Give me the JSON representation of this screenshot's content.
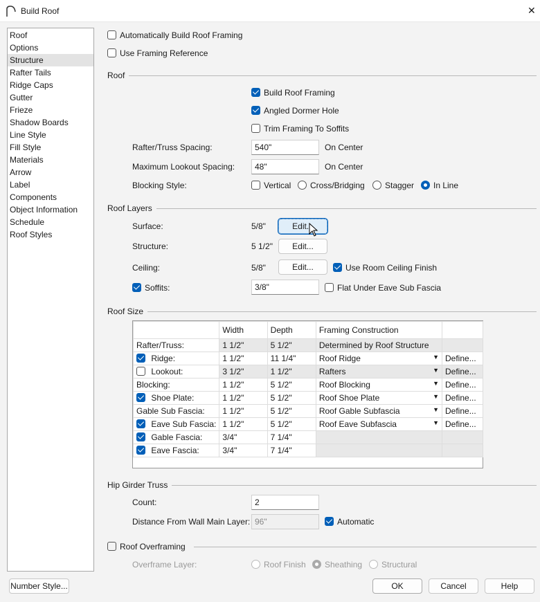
{
  "window": {
    "title": "Build Roof",
    "close": "✕"
  },
  "sidebar": {
    "items": [
      "Roof",
      "Options",
      "Structure",
      "Rafter Tails",
      "Ridge Caps",
      "Gutter",
      "Frieze",
      "Shadow Boards",
      "Line Style",
      "Fill Style",
      "Materials",
      "Arrow",
      "Label",
      "Components",
      "Object Information",
      "Schedule",
      "Roof Styles"
    ],
    "selected": "Structure"
  },
  "top": {
    "auto_build": {
      "label": "Automatically Build Roof Framing",
      "checked": false
    },
    "framing_ref": {
      "label": "Use Framing Reference",
      "checked": false
    }
  },
  "roof": {
    "section": "Roof",
    "build_framing": {
      "label": "Build Roof Framing",
      "checked": true
    },
    "angled_dormer": {
      "label": "Angled Dormer Hole",
      "checked": true
    },
    "trim_soffits": {
      "label": "Trim Framing To Soffits",
      "checked": false
    },
    "spacing_label": "Rafter/Truss Spacing:",
    "spacing_value": "540\"",
    "on_center": "On Center",
    "lookout_label": "Maximum Lookout Spacing:",
    "lookout_value": "48\"",
    "blocking_label": "Blocking Style:",
    "blocking": {
      "vertical": "Vertical",
      "cross": "Cross/Bridging",
      "stagger": "Stagger",
      "inline": "In Line",
      "selected": "In Line"
    }
  },
  "layers": {
    "section": "Roof Layers",
    "surface_label": "Surface:",
    "surface_value": "5/8\"",
    "structure_label": "Structure:",
    "structure_value": "5 1/2\"",
    "ceiling_label": "Ceiling:",
    "ceiling_value": "5/8\"",
    "edit": "Edit...",
    "use_room": "Use Room Ceiling Finish",
    "soffits_label": "Soffits:",
    "soffits_value": "3/8\"",
    "flat_under": "Flat Under Eave Sub Fascia"
  },
  "size": {
    "section": "Roof Size",
    "headers": [
      "",
      "Width",
      "Depth",
      "Framing Construction",
      ""
    ],
    "rows": [
      {
        "label": "Rafter/Truss:",
        "check": null,
        "width": "1 1/2\"",
        "depth": "5 1/2\"",
        "framing": "Determined by Roof Structure",
        "define": "",
        "dropdown": false,
        "gray": true
      },
      {
        "label": "Ridge:",
        "check": true,
        "width": "1 1/2\"",
        "depth": "11 1/4\"",
        "framing": "Roof Ridge",
        "define": "Define...",
        "dropdown": true
      },
      {
        "label": "Lookout:",
        "check": false,
        "width": "3 1/2\"",
        "depth": "1 1/2\"",
        "framing": "Rafters",
        "define": "Define...",
        "dropdown": true,
        "gray": true
      },
      {
        "label": "Blocking:",
        "check": null,
        "width": "1 1/2\"",
        "depth": "5 1/2\"",
        "framing": "Roof Blocking",
        "define": "Define...",
        "dropdown": true
      },
      {
        "label": "Shoe Plate:",
        "check": true,
        "width": "1 1/2\"",
        "depth": "5 1/2\"",
        "framing": "Roof Shoe Plate",
        "define": "Define...",
        "dropdown": true
      },
      {
        "label": "Gable Sub Fascia:",
        "check": null,
        "width": "1 1/2\"",
        "depth": "5 1/2\"",
        "framing": "Roof Gable Subfascia",
        "define": "Define...",
        "dropdown": true
      },
      {
        "label": "Eave Sub Fascia:",
        "check": true,
        "width": "1 1/2\"",
        "depth": "5 1/2\"",
        "framing": "Roof Eave Subfascia",
        "define": "Define...",
        "dropdown": true
      },
      {
        "label": "Gable Fascia:",
        "check": true,
        "width": "3/4\"",
        "depth": "7 1/4\"",
        "framing": "",
        "define": "",
        "dropdown": false
      },
      {
        "label": "Eave Fascia:",
        "check": true,
        "width": "3/4\"",
        "depth": "7 1/4\"",
        "framing": "",
        "define": "",
        "dropdown": false
      }
    ]
  },
  "hip": {
    "section": "Hip Girder Truss",
    "count_label": "Count:",
    "count_value": "2",
    "distance_label": "Distance From Wall Main Layer:",
    "distance_value": "96\"",
    "automatic": "Automatic"
  },
  "overframe": {
    "label": "Roof Overframing",
    "layer_label": "Overframe Layer:",
    "options": [
      "Roof Finish",
      "Sheathing",
      "Structural"
    ],
    "selected": "Sheathing"
  },
  "buttons": {
    "number_style": "Number Style...",
    "ok": "OK",
    "cancel": "Cancel",
    "help": "Help"
  }
}
